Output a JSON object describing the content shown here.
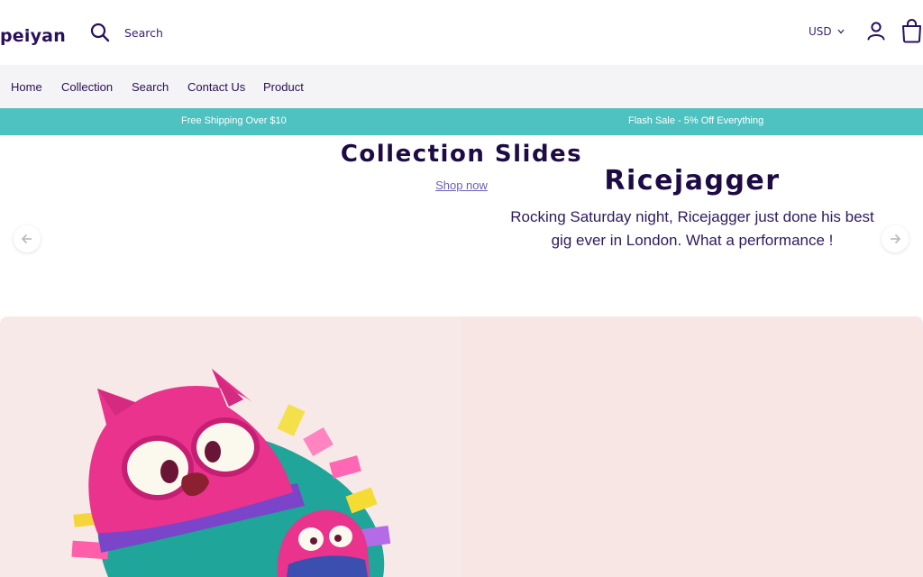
{
  "header": {
    "logo_text": "peiyan",
    "search_label": "Search",
    "currency": "USD"
  },
  "nav": {
    "items": [
      {
        "label": "Home"
      },
      {
        "label": "Collection"
      },
      {
        "label": "Search"
      },
      {
        "label": "Contact Us"
      },
      {
        "label": "Product"
      }
    ]
  },
  "announcement": {
    "left": "Free Shipping Over $10",
    "right": "Flash Sale - 5% Off  Everything"
  },
  "slideshow": {
    "title": "Collection Slides",
    "cta": "Shop now"
  },
  "feature": {
    "heading": "Ricejagger",
    "description": "Rocking Saturday night, Ricejagger just done his best gig ever in  London. What a performance !"
  },
  "colors": {
    "brand": "#2a0f5c",
    "announcement_bg": "#4ec2c0",
    "nav_bg": "#f4f3f6",
    "feature_bg": "#f8e6e5"
  },
  "icons": [
    "search-icon",
    "chevron-down-icon",
    "account-icon",
    "cart-icon",
    "arrow-left-icon",
    "arrow-right-icon"
  ]
}
